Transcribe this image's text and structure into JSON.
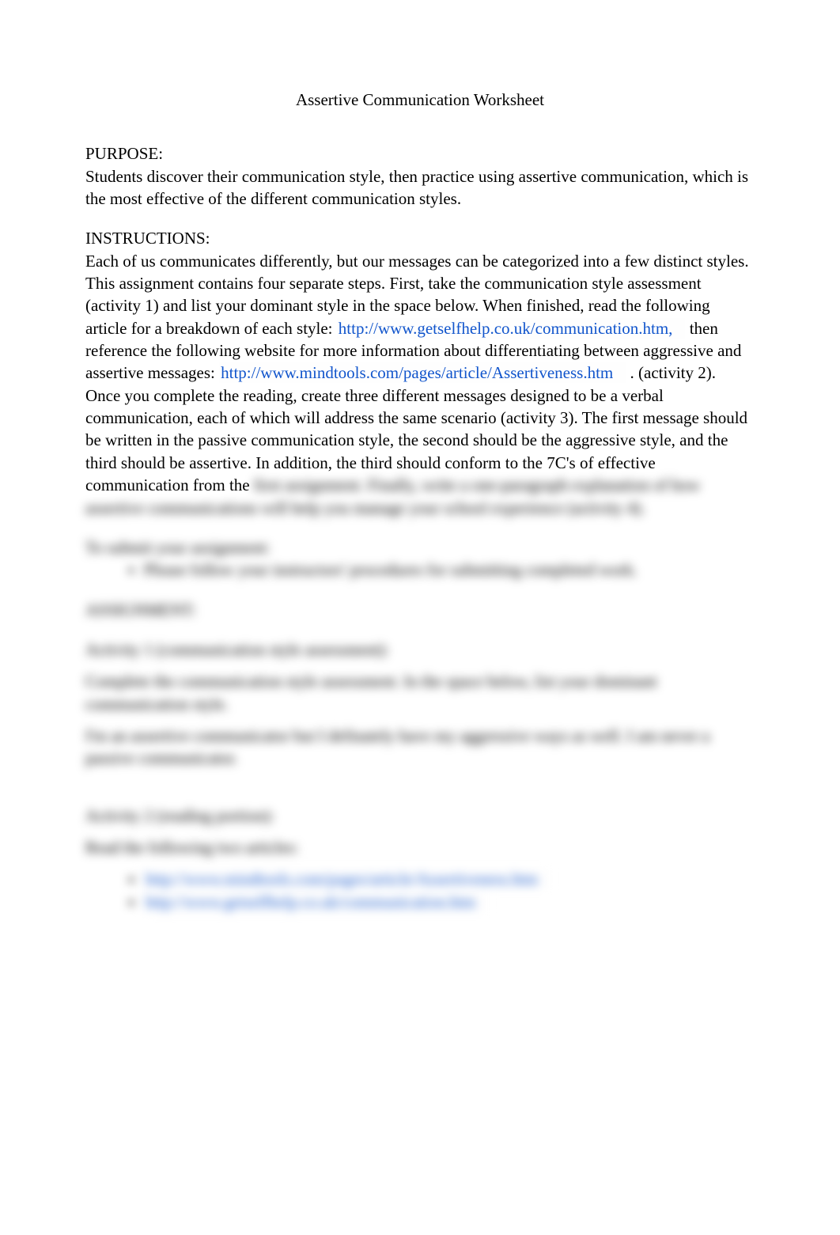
{
  "title": "Assertive Communication Worksheet",
  "purpose": {
    "heading": "PURPOSE:",
    "text": "Students discover their communication style, then practice using assertive communication, which is the most effective of the different communication styles."
  },
  "instructions": {
    "heading": "INSTRUCTIONS:",
    "intro": "Each of us communicates differently, but our messages can be categorized into a few distinct styles. This assignment contains four separate steps. First, take the communication style assessment (activity 1) and list your dominant style in the space below. When finished, read the following article for a breakdown of each style: ",
    "link1": "http://www.getselfhelp.co.uk/communication.htm,",
    "mid1": " then reference the following website for more information about differentiating between aggressive and assertive messages: ",
    "link2": "http://www.mindtools.com/pages/article/Assertiveness.htm",
    "mid2": ". (activity 2). Once you complete the reading, create three different messages designed to be a verbal communication, each of which will address the same scenario (activity 3). The first message should be written in the passive communication style, the second should be the aggressive style, and the third should be assertive. In addition, the third should conform to the 7C's of effective communication from the ",
    "tail": "first assignment. Finally, write a one-paragraph explanation of how assertive communications will help you manage your school experience (activity 4)."
  },
  "submit": {
    "heading": "To submit your assignment:",
    "item": "Please follow your instructors' procedures for submitting completed work."
  },
  "assignment": {
    "heading": "ASSIGNMENT:"
  },
  "activity1": {
    "heading": "Activity 1 (communication style assessment):",
    "body": "Complete the communication style assessment. In the space below, list your dominant communication style.",
    "answer": "I'm an assertive communicator but I definately have my aggressive ways as well. I am never a passive communicator."
  },
  "activity2": {
    "heading": "Activity 2 (reading portion):",
    "body": "Read the following two articles:",
    "link1": "http://www.mindtools.com/pages/article/Assertiveness.htm",
    "link2": "http://www.getselfhelp.co.uk/communication.htm"
  }
}
